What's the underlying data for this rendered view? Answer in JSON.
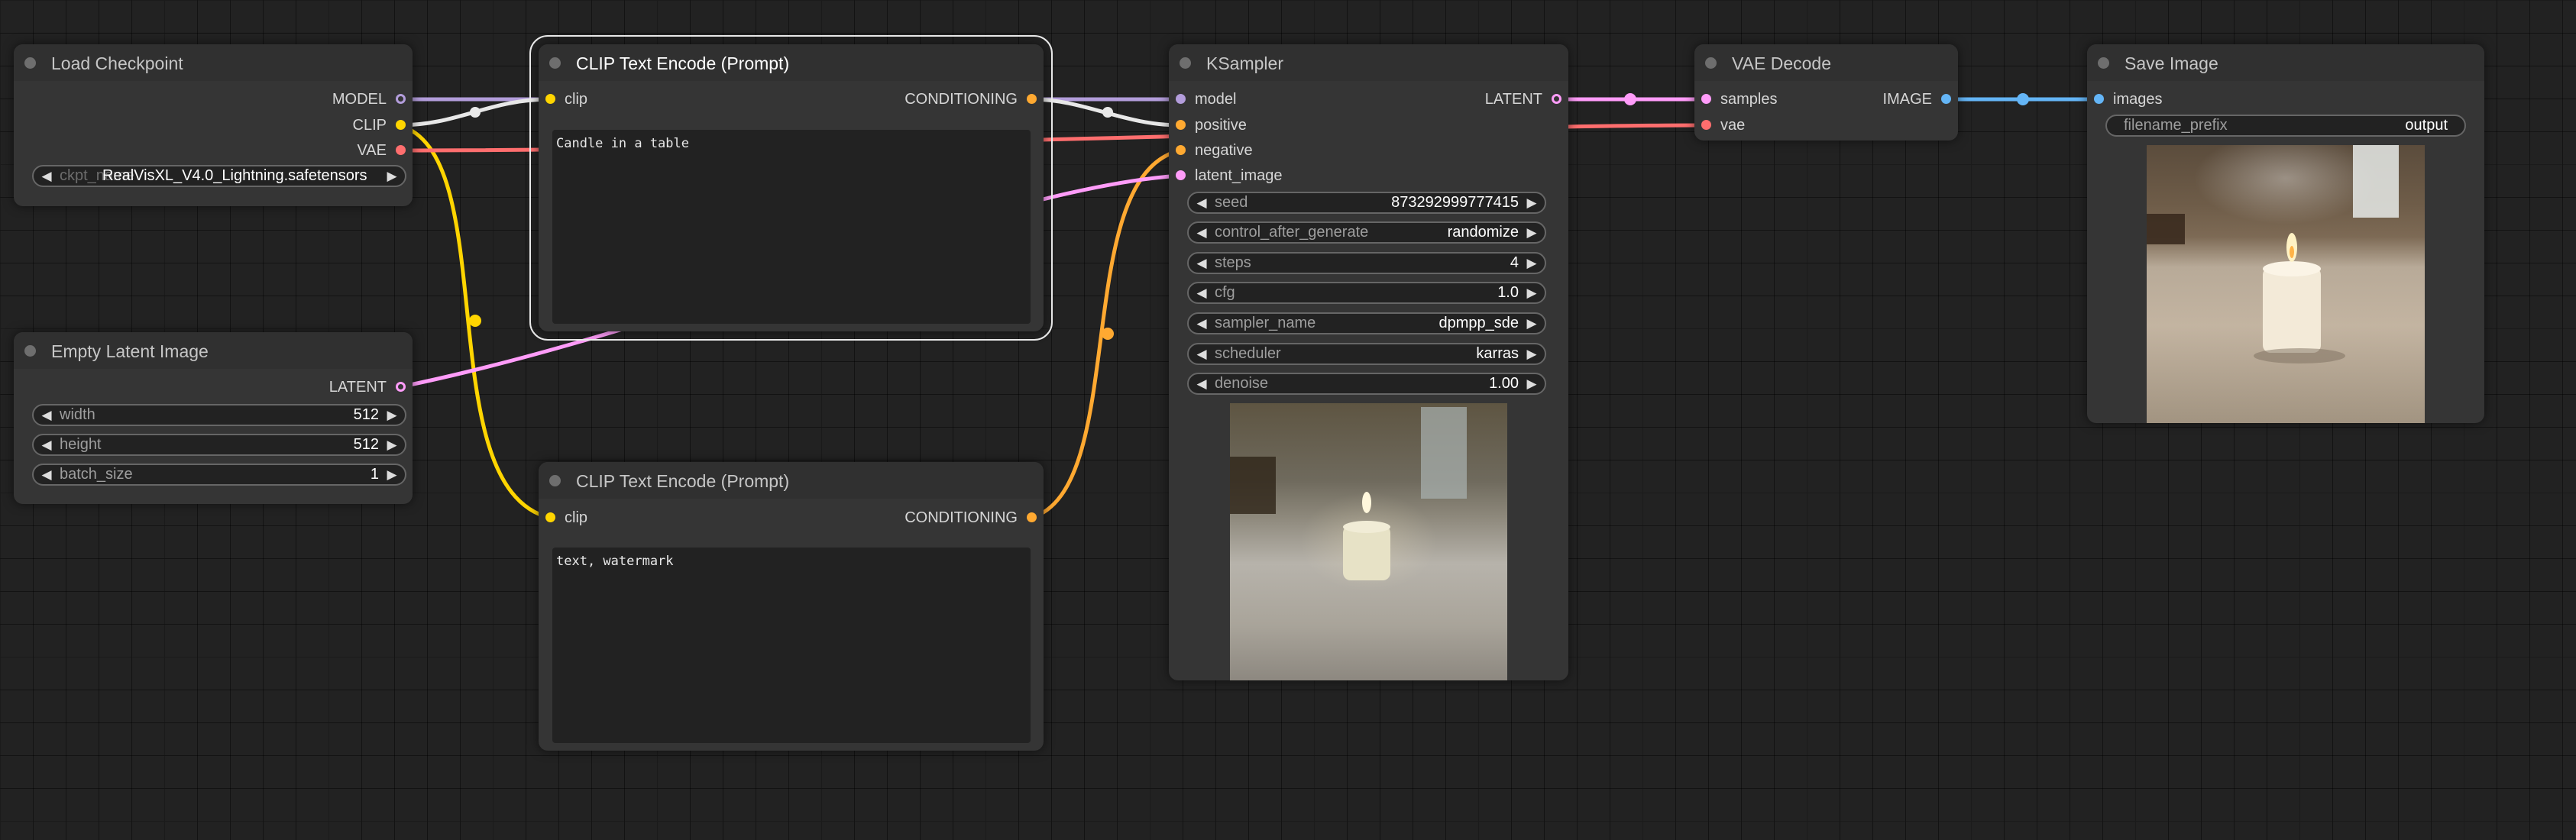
{
  "nodes": {
    "load_checkpoint": {
      "title": "Load Checkpoint",
      "outputs": [
        "MODEL",
        "CLIP",
        "VAE"
      ],
      "ckpt_name": {
        "label": "ckpt_name",
        "value": "RealVisXL_V4.0_Lightning.safetensors"
      }
    },
    "empty_latent": {
      "title": "Empty Latent Image",
      "output": "LATENT",
      "widgets": [
        {
          "label": "width",
          "value": "512"
        },
        {
          "label": "height",
          "value": "512"
        },
        {
          "label": "batch_size",
          "value": "1"
        }
      ]
    },
    "clip_positive": {
      "title": "CLIP Text Encode (Prompt)",
      "input": "clip",
      "output": "CONDITIONING",
      "text": "Candle in a table"
    },
    "clip_negative": {
      "title": "CLIP Text Encode (Prompt)",
      "input": "clip",
      "output": "CONDITIONING",
      "text": "text, watermark"
    },
    "ksampler": {
      "title": "KSampler",
      "inputs": [
        "model",
        "positive",
        "negative",
        "latent_image"
      ],
      "output": "LATENT",
      "widgets": [
        {
          "label": "seed",
          "value": "873292999777415"
        },
        {
          "label": "control_after_generate",
          "value": "randomize"
        },
        {
          "label": "steps",
          "value": "4"
        },
        {
          "label": "cfg",
          "value": "1.0"
        },
        {
          "label": "sampler_name",
          "value": "dpmpp_sde"
        },
        {
          "label": "scheduler",
          "value": "karras"
        },
        {
          "label": "denoise",
          "value": "1.00"
        }
      ],
      "preview_image": "blurry candle on table"
    },
    "vae_decode": {
      "title": "VAE Decode",
      "inputs": [
        "samples",
        "vae"
      ],
      "output": "IMAGE"
    },
    "save_image": {
      "title": "Save Image",
      "input": "images",
      "filename_prefix": {
        "label": "filename_prefix",
        "value": "output"
      },
      "preview_image": "lit candle on wooden table"
    }
  },
  "colors": {
    "canvas": "#222222",
    "node_body": "#353535",
    "node_title": "#303030",
    "model": "#b39ddb",
    "clip": "#ffd500",
    "vae": "#ff6e6e",
    "conditioning": "#ffa931",
    "latent": "#ff9cf9",
    "image": "#64b5f6",
    "link_white": "#e8e8e8"
  },
  "icons": {
    "widget_decrement": "◀",
    "widget_increment": "▶"
  }
}
